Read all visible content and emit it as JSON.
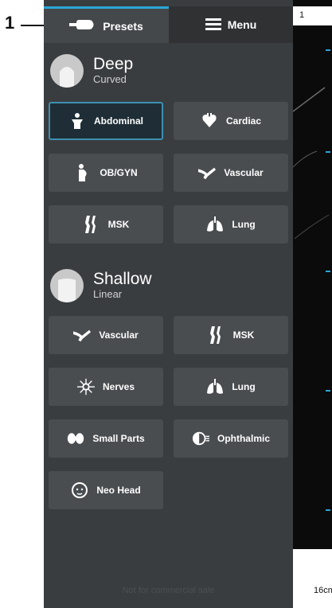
{
  "callout": {
    "number": "1"
  },
  "tabs": [
    {
      "label": "Presets",
      "icon": "probe-icon",
      "active": true
    },
    {
      "label": "Menu",
      "icon": "hamburger-icon",
      "active": false
    }
  ],
  "groups": [
    {
      "title": "Deep",
      "subtitle": "Curved",
      "presets": [
        {
          "label": "Abdominal",
          "icon": "abdominal-icon",
          "selected": true
        },
        {
          "label": "Cardiac",
          "icon": "heart-icon",
          "selected": false
        },
        {
          "label": "OB/GYN",
          "icon": "pregnancy-icon",
          "selected": false
        },
        {
          "label": "Vascular",
          "icon": "vessel-icon",
          "selected": false
        },
        {
          "label": "MSK",
          "icon": "knee-joint-icon",
          "selected": false
        },
        {
          "label": "Lung",
          "icon": "lungs-icon",
          "selected": false
        }
      ]
    },
    {
      "title": "Shallow",
      "subtitle": "Linear",
      "presets": [
        {
          "label": "Vascular",
          "icon": "vessel-icon",
          "selected": false
        },
        {
          "label": "MSK",
          "icon": "knee-joint-icon",
          "selected": false
        },
        {
          "label": "Nerves",
          "icon": "nerve-icon",
          "selected": false
        },
        {
          "label": "Lung",
          "icon": "lungs-icon",
          "selected": false
        },
        {
          "label": "Small Parts",
          "icon": "thyroid-icon",
          "selected": false
        },
        {
          "label": "Ophthalmic",
          "icon": "eye-icon",
          "selected": false
        },
        {
          "label": "Neo Head",
          "icon": "baby-head-icon",
          "selected": false
        }
      ]
    }
  ],
  "footer": {
    "text": "Not for commercial sale"
  },
  "image_panel": {
    "top_label": "1",
    "depth": "16cm"
  }
}
